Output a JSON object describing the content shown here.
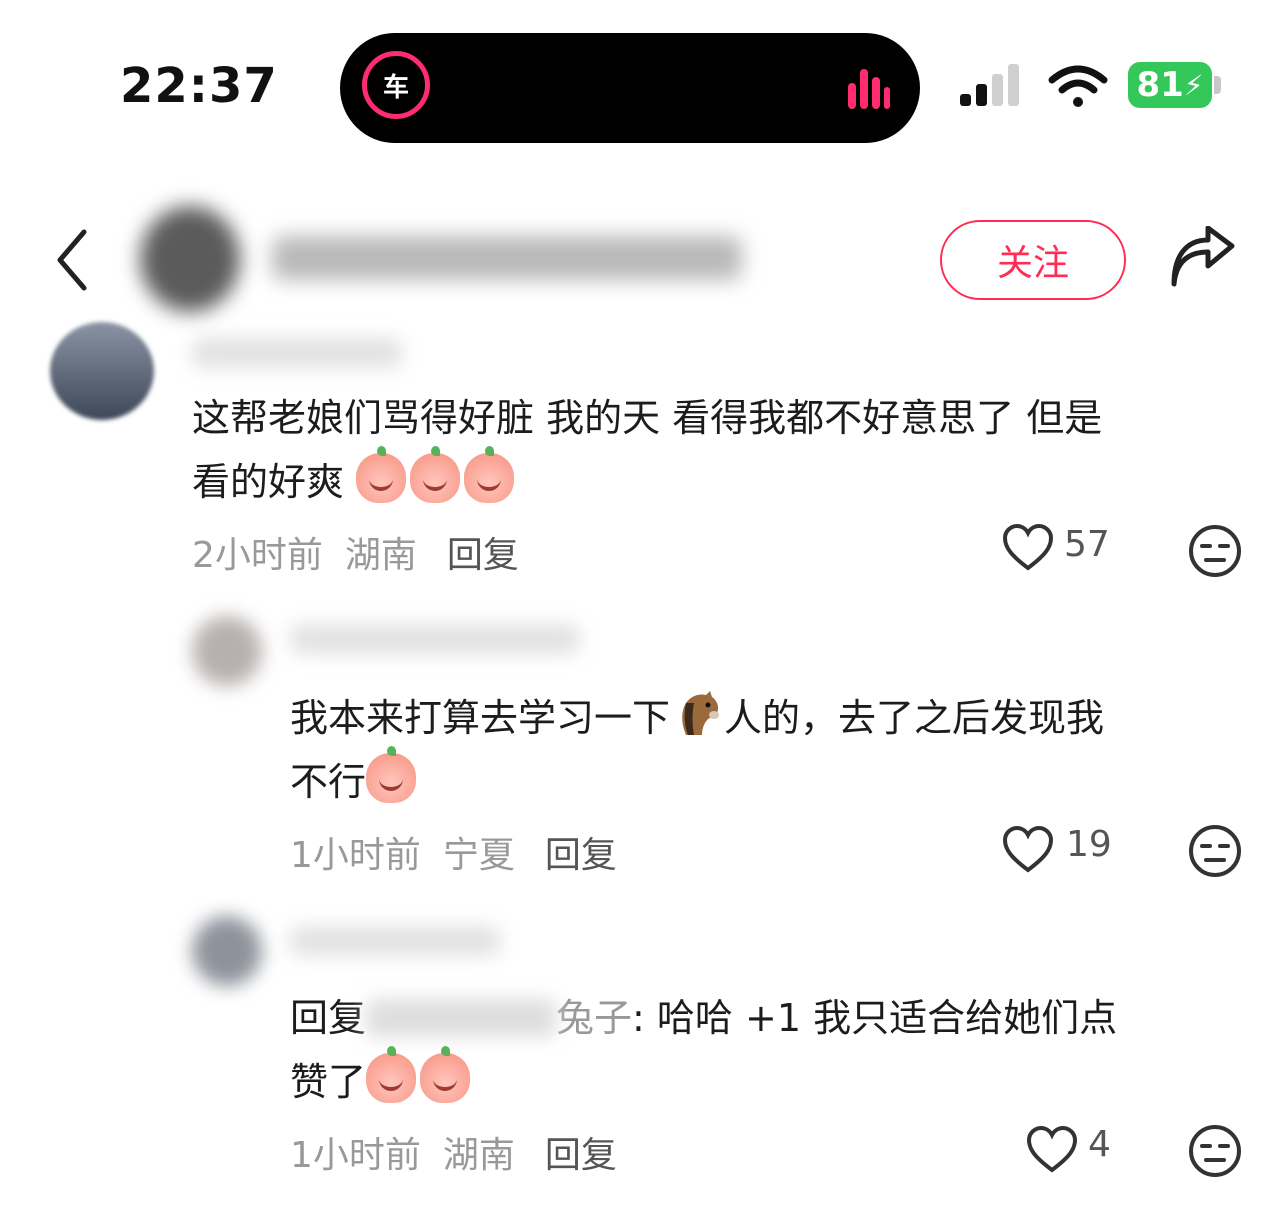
{
  "status_bar": {
    "time": "22:37",
    "island_badge": "车",
    "battery": "81"
  },
  "header": {
    "follow_label": "关注",
    "accent_color": "#ff2d55"
  },
  "comments": [
    {
      "text_line1": "这帮老娘们骂得好脏 我的天 看得我都不好意思了 但是",
      "text_line2": "看的好爽",
      "time": "2小时前",
      "region": "湖南",
      "reply_label": "回复",
      "likes": "57"
    },
    {
      "text_line1_a": "我本来打算去学习一下",
      "text_line1_b": "人的，去了之后发现我",
      "text_line2": "不行",
      "time": "1小时前",
      "region": "宁夏",
      "reply_label": "回复",
      "likes": "19"
    },
    {
      "reply_prefix": "回复",
      "reply_target_visible": "兔子",
      "text_line1": ": 哈哈 +1 我只适合给她们点",
      "text_line2": "赞了",
      "time": "1小时前",
      "region": "湖南",
      "reply_label": "回复",
      "likes": "4"
    }
  ],
  "icons": [
    "car-badge",
    "audio-bars-icon",
    "signal-icon",
    "wifi-icon",
    "battery-icon",
    "back-icon",
    "share-icon",
    "heart-icon",
    "meh-face-icon",
    "peach-emoji",
    "horse-emoji"
  ]
}
